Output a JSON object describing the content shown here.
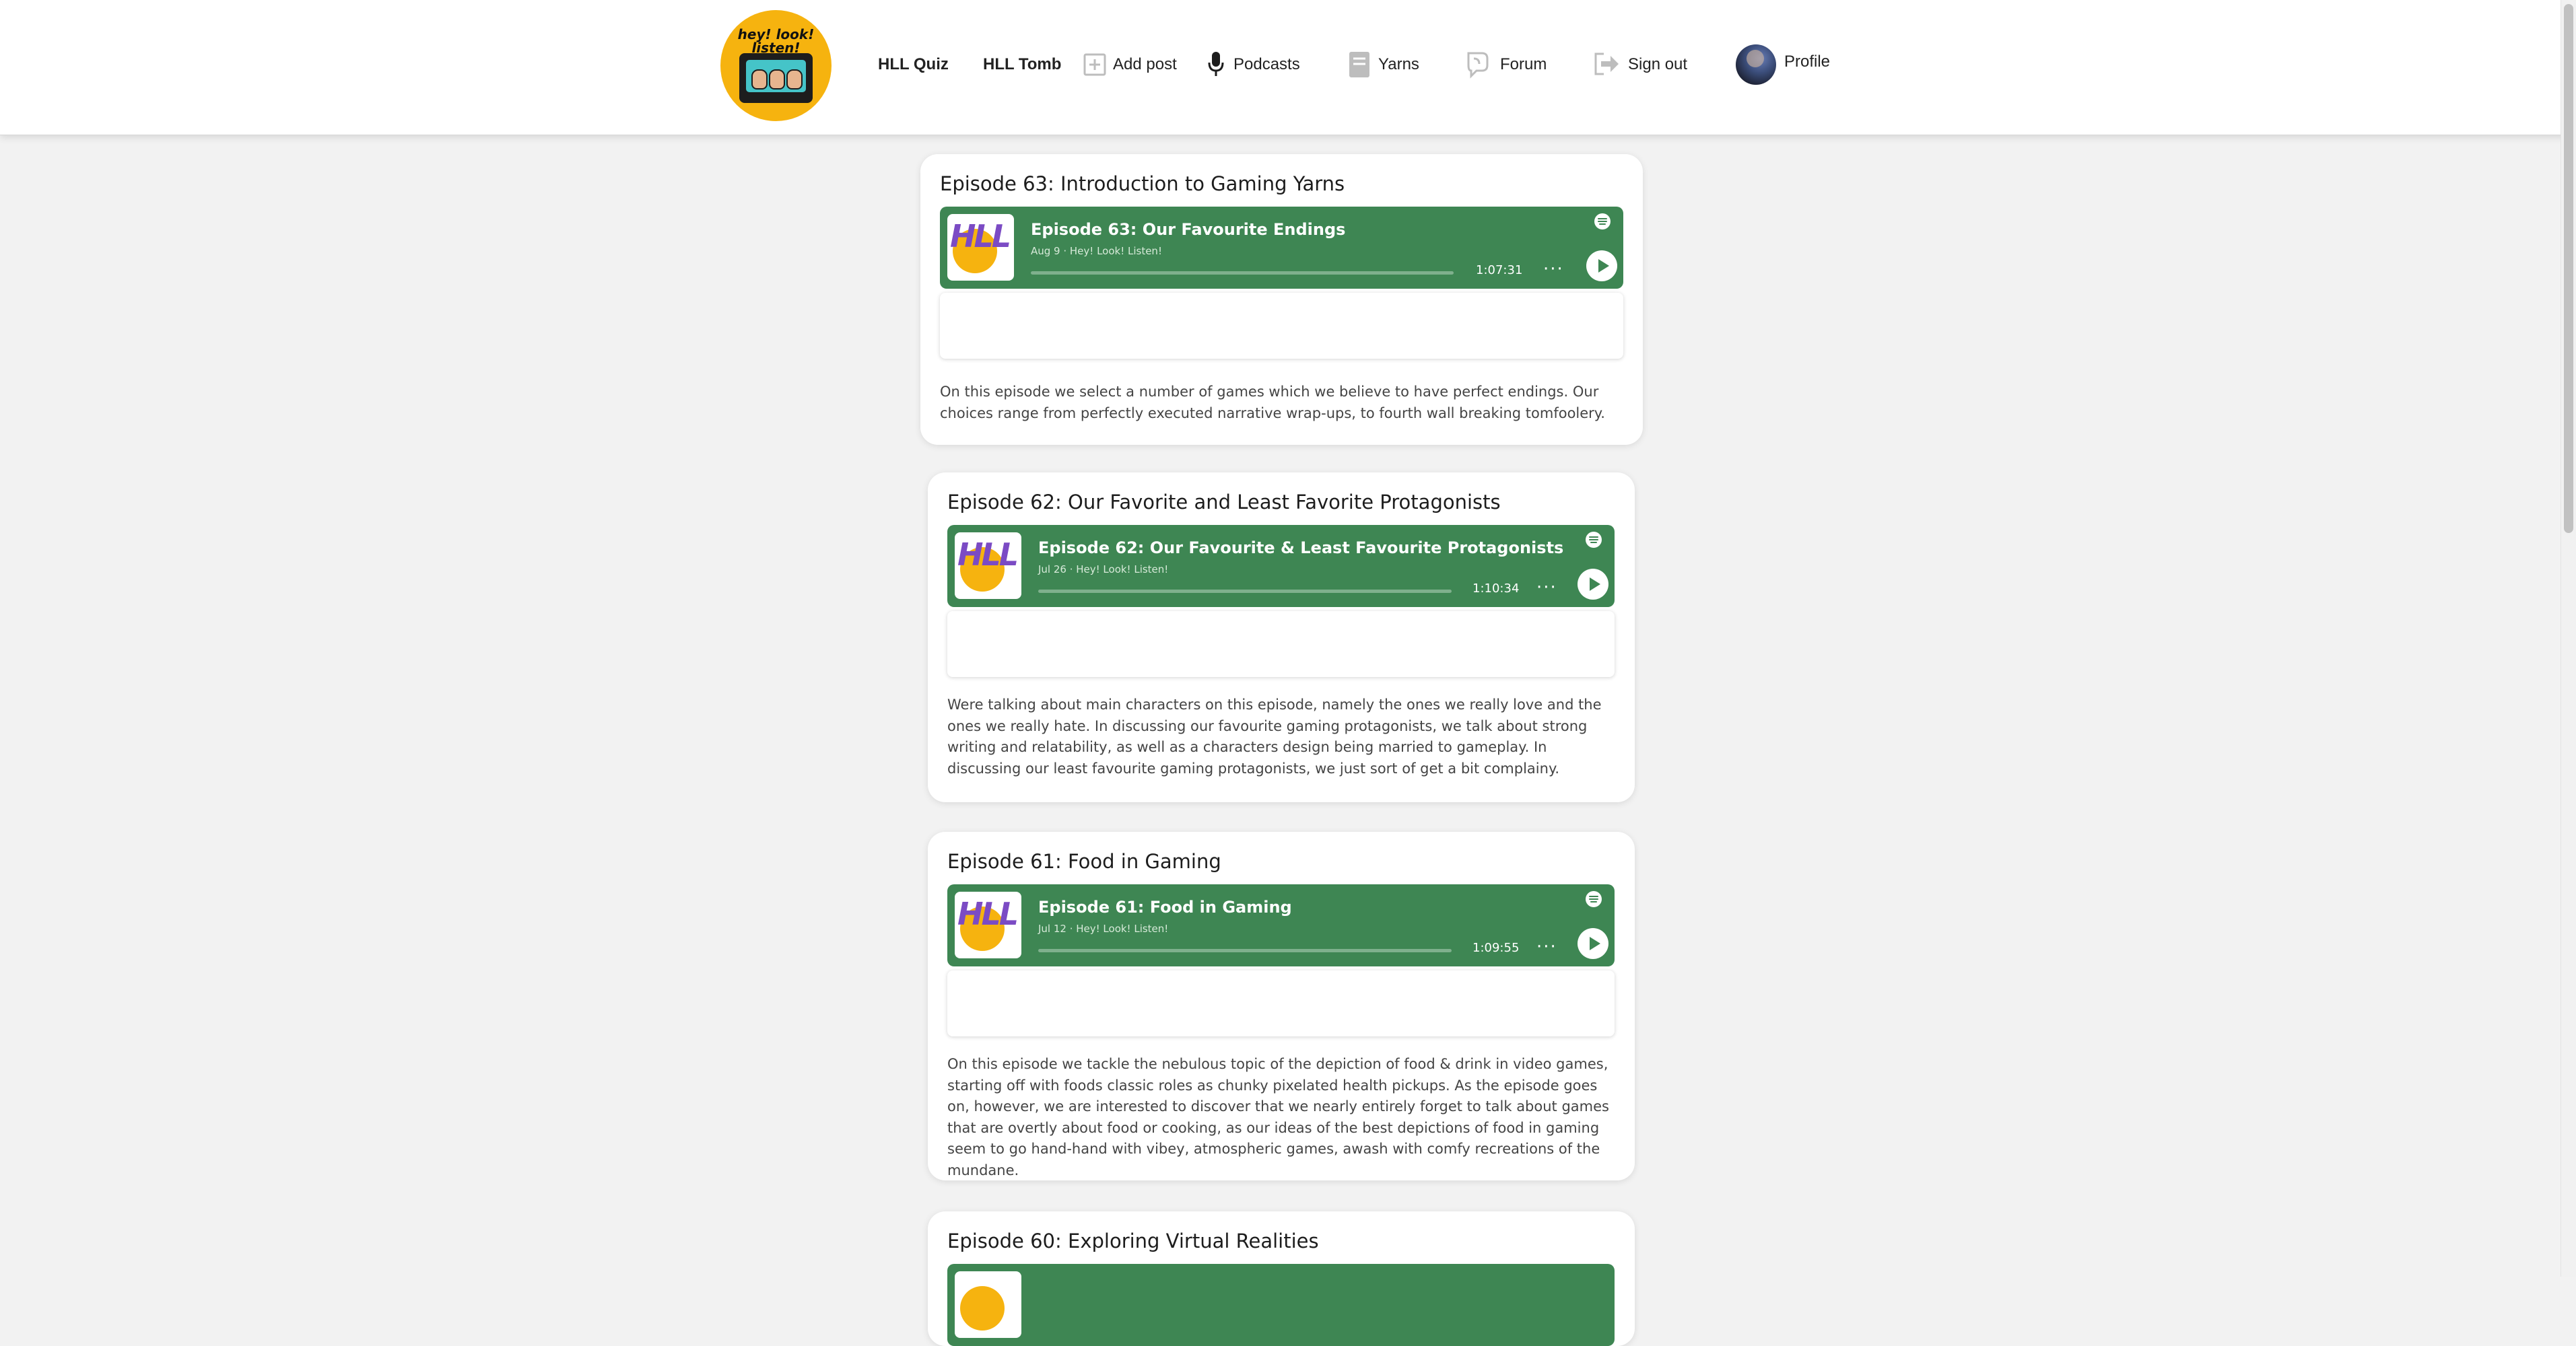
{
  "header": {
    "logo_text": "hey! look! listen!",
    "nav": [
      {
        "label": "HLL Quiz"
      },
      {
        "label": "HLL Tomb"
      },
      {
        "label": "Add post",
        "icon": "plus-square-icon"
      },
      {
        "label": "Podcasts",
        "icon": "microphone-icon"
      },
      {
        "label": "Yarns",
        "icon": "book-icon"
      },
      {
        "label": "Forum",
        "icon": "chat-icon"
      },
      {
        "label": "Sign out",
        "icon": "sign-out-icon"
      },
      {
        "label": "Profile",
        "icon": "avatar"
      }
    ]
  },
  "colors": {
    "player_green": "#3e8653",
    "logo_yellow": "#f6b30f",
    "page_bg": "#f2f2f2"
  },
  "episodes": [
    {
      "title": "Episode 63: Introduction to Gaming Yarns",
      "player": {
        "name": "Episode 63: Our Favourite Endings",
        "meta": "Aug 9 · Hey! Look! Listen!",
        "duration": "1:07:31",
        "cover_text": "HLL"
      },
      "description": "On this episode we select a number of games which we believe to have perfect endings. Our choices range from perfectly executed narrative wrap-ups, to fourth wall breaking tomfoolery."
    },
    {
      "title": "Episode 62: Our Favorite and Least Favorite Protagonists",
      "player": {
        "name": "Episode 62: Our Favourite & Least Favourite Protagonists",
        "meta": "Jul 26 · Hey! Look! Listen!",
        "duration": "1:10:34",
        "cover_text": "HLL"
      },
      "description": "Were talking about main characters on this episode, namely the ones we really love and the ones we really hate. In discussing our favourite gaming protagonists, we talk about strong writing and relatability, as well as a characters design being married to gameplay. In discussing our least favourite gaming protagonists, we just sort of get a bit complainy."
    },
    {
      "title": "Episode 61: Food in Gaming",
      "player": {
        "name": "Episode 61: Food in Gaming",
        "meta": "Jul 12 · Hey! Look! Listen!",
        "duration": "1:09:55",
        "cover_text": "HLL"
      },
      "description": "On this episode we tackle the nebulous topic of the depiction of food & drink in video games, starting off with foods classic roles as chunky pixelated health pickups. As the episode goes on, however, we are interested to discover that we nearly entirely forget to talk about games that are overtly about food or cooking, as our ideas of the best depictions of food in gaming seem to go hand-hand with vibey, atmospheric games, awash with comfy recreations of the mundane."
    },
    {
      "title": "Episode 60: Exploring Virtual Realities"
    }
  ]
}
